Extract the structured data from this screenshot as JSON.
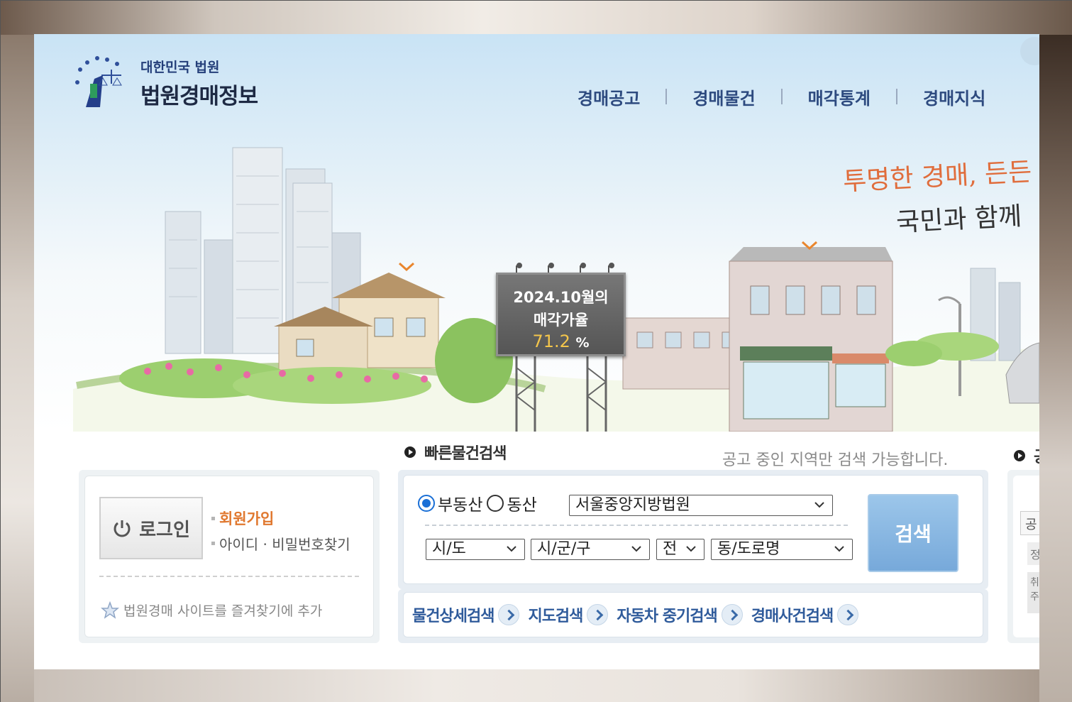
{
  "logo": {
    "small": "대한민국 법원",
    "title": "법원경매정보"
  },
  "gnb": [
    {
      "label": "경매공고"
    },
    {
      "label": "경매물건"
    },
    {
      "label": "매각통계"
    },
    {
      "label": "경매지식"
    }
  ],
  "slogan": {
    "line1": "투명한 경매, 든든",
    "line2": "국민과 함께"
  },
  "billboard": {
    "line1": "2024.10월의",
    "line2": "매각가율",
    "value": "71.2",
    "unit": "%"
  },
  "login": {
    "button_label": "로그인",
    "join_label": "회원가입",
    "find_label": "아이디 · 비밀번호찾기",
    "favorite_label": "법원경매 사이트를 즐겨찾기에 추가"
  },
  "quick_search": {
    "title": "빠른물건검색",
    "note": "공고 중인 지역만 검색 가능합니다.",
    "radio_realestate": "부동산",
    "radio_movable": "동산",
    "court_selected": "서울중앙지방법원",
    "sido": "시/도",
    "sigungu": "시/군/구",
    "jeon": "전",
    "dong": "동/도로명",
    "search_button": "검색"
  },
  "quick_links": [
    {
      "label": "물건상세검색"
    },
    {
      "label": "지도검색"
    },
    {
      "label": "자동차 중기검색"
    },
    {
      "label": "경매사건검색"
    }
  ],
  "right_panel": {
    "title_partial": "공",
    "a": "공",
    "b": "정",
    "c": "취주"
  },
  "colors": {
    "nav": "#2d4a7f",
    "accent_orange": "#e0782f",
    "billboard_value": "#f3c54b",
    "search_button": "#77a9da"
  }
}
